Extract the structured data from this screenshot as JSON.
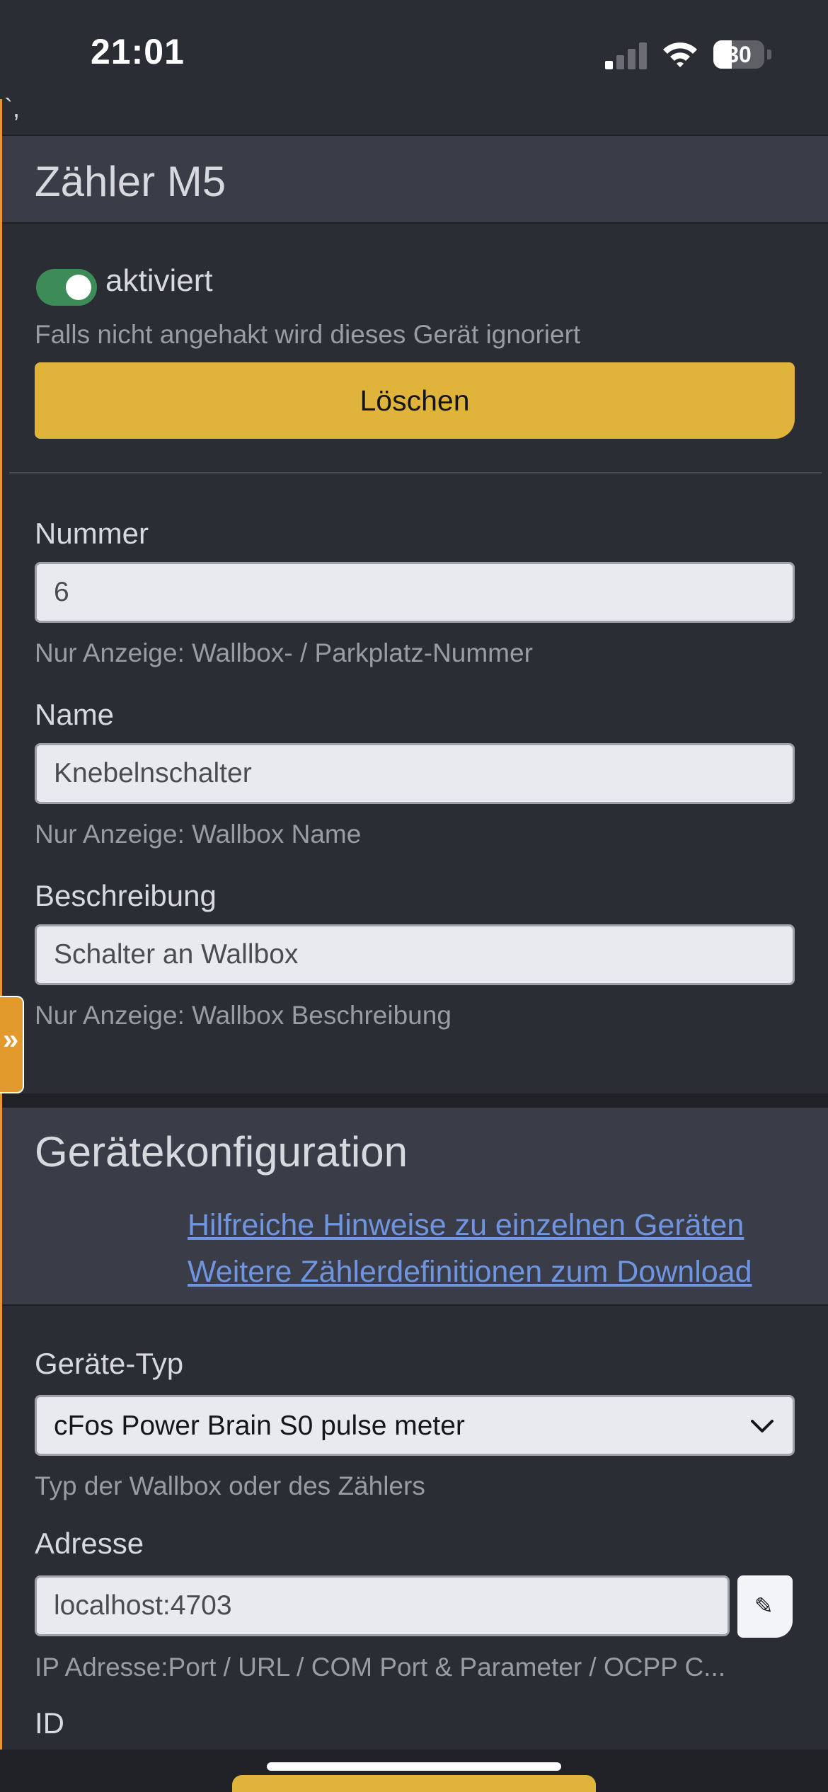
{
  "status_bar": {
    "time": "21:01",
    "battery": "30"
  },
  "stray_text": "`,",
  "meter_card": {
    "title": "Zähler M5",
    "enabled_toggle": {
      "label": "aktiviert",
      "on": true
    },
    "enabled_help": "Falls nicht angehakt wird dieses Gerät ignoriert",
    "delete_button": "Löschen",
    "fields": {
      "number": {
        "label": "Nummer",
        "value": "6",
        "help": "Nur Anzeige: Wallbox- / Parkplatz-Nummer"
      },
      "name": {
        "label": "Name",
        "value": "Knebelnschalter",
        "help": "Nur Anzeige: Wallbox Name"
      },
      "description": {
        "label": "Beschreibung",
        "value": "Schalter an Wallbox",
        "help": "Nur Anzeige: Wallbox Beschreibung"
      }
    }
  },
  "side_tab": {
    "icon": "»"
  },
  "device_config": {
    "title": "Gerätekonfiguration",
    "links": [
      "Hilfreiche Hinweise zu einzelnen Geräten",
      "Weitere Zählerdefinitionen zum Download"
    ],
    "device_type": {
      "label": "Geräte-Typ",
      "value": "cFos Power Brain S0 pulse meter",
      "help": "Typ der Wallbox oder des Zählers"
    },
    "address": {
      "label": "Adresse",
      "value": "localhost:4703",
      "help": "IP Adresse:Port / URL / COM Port & Parameter / OCPP C...",
      "edit_icon": "✎"
    },
    "id": {
      "label": "ID"
    }
  },
  "colors": {
    "background": "#2b2d34",
    "header": "#3a3d48",
    "accent_yellow": "#e0b43b",
    "toggle_green": "#3d8b57",
    "link_blue": "#6f95e0",
    "side_tab_orange": "#e39a2c"
  }
}
